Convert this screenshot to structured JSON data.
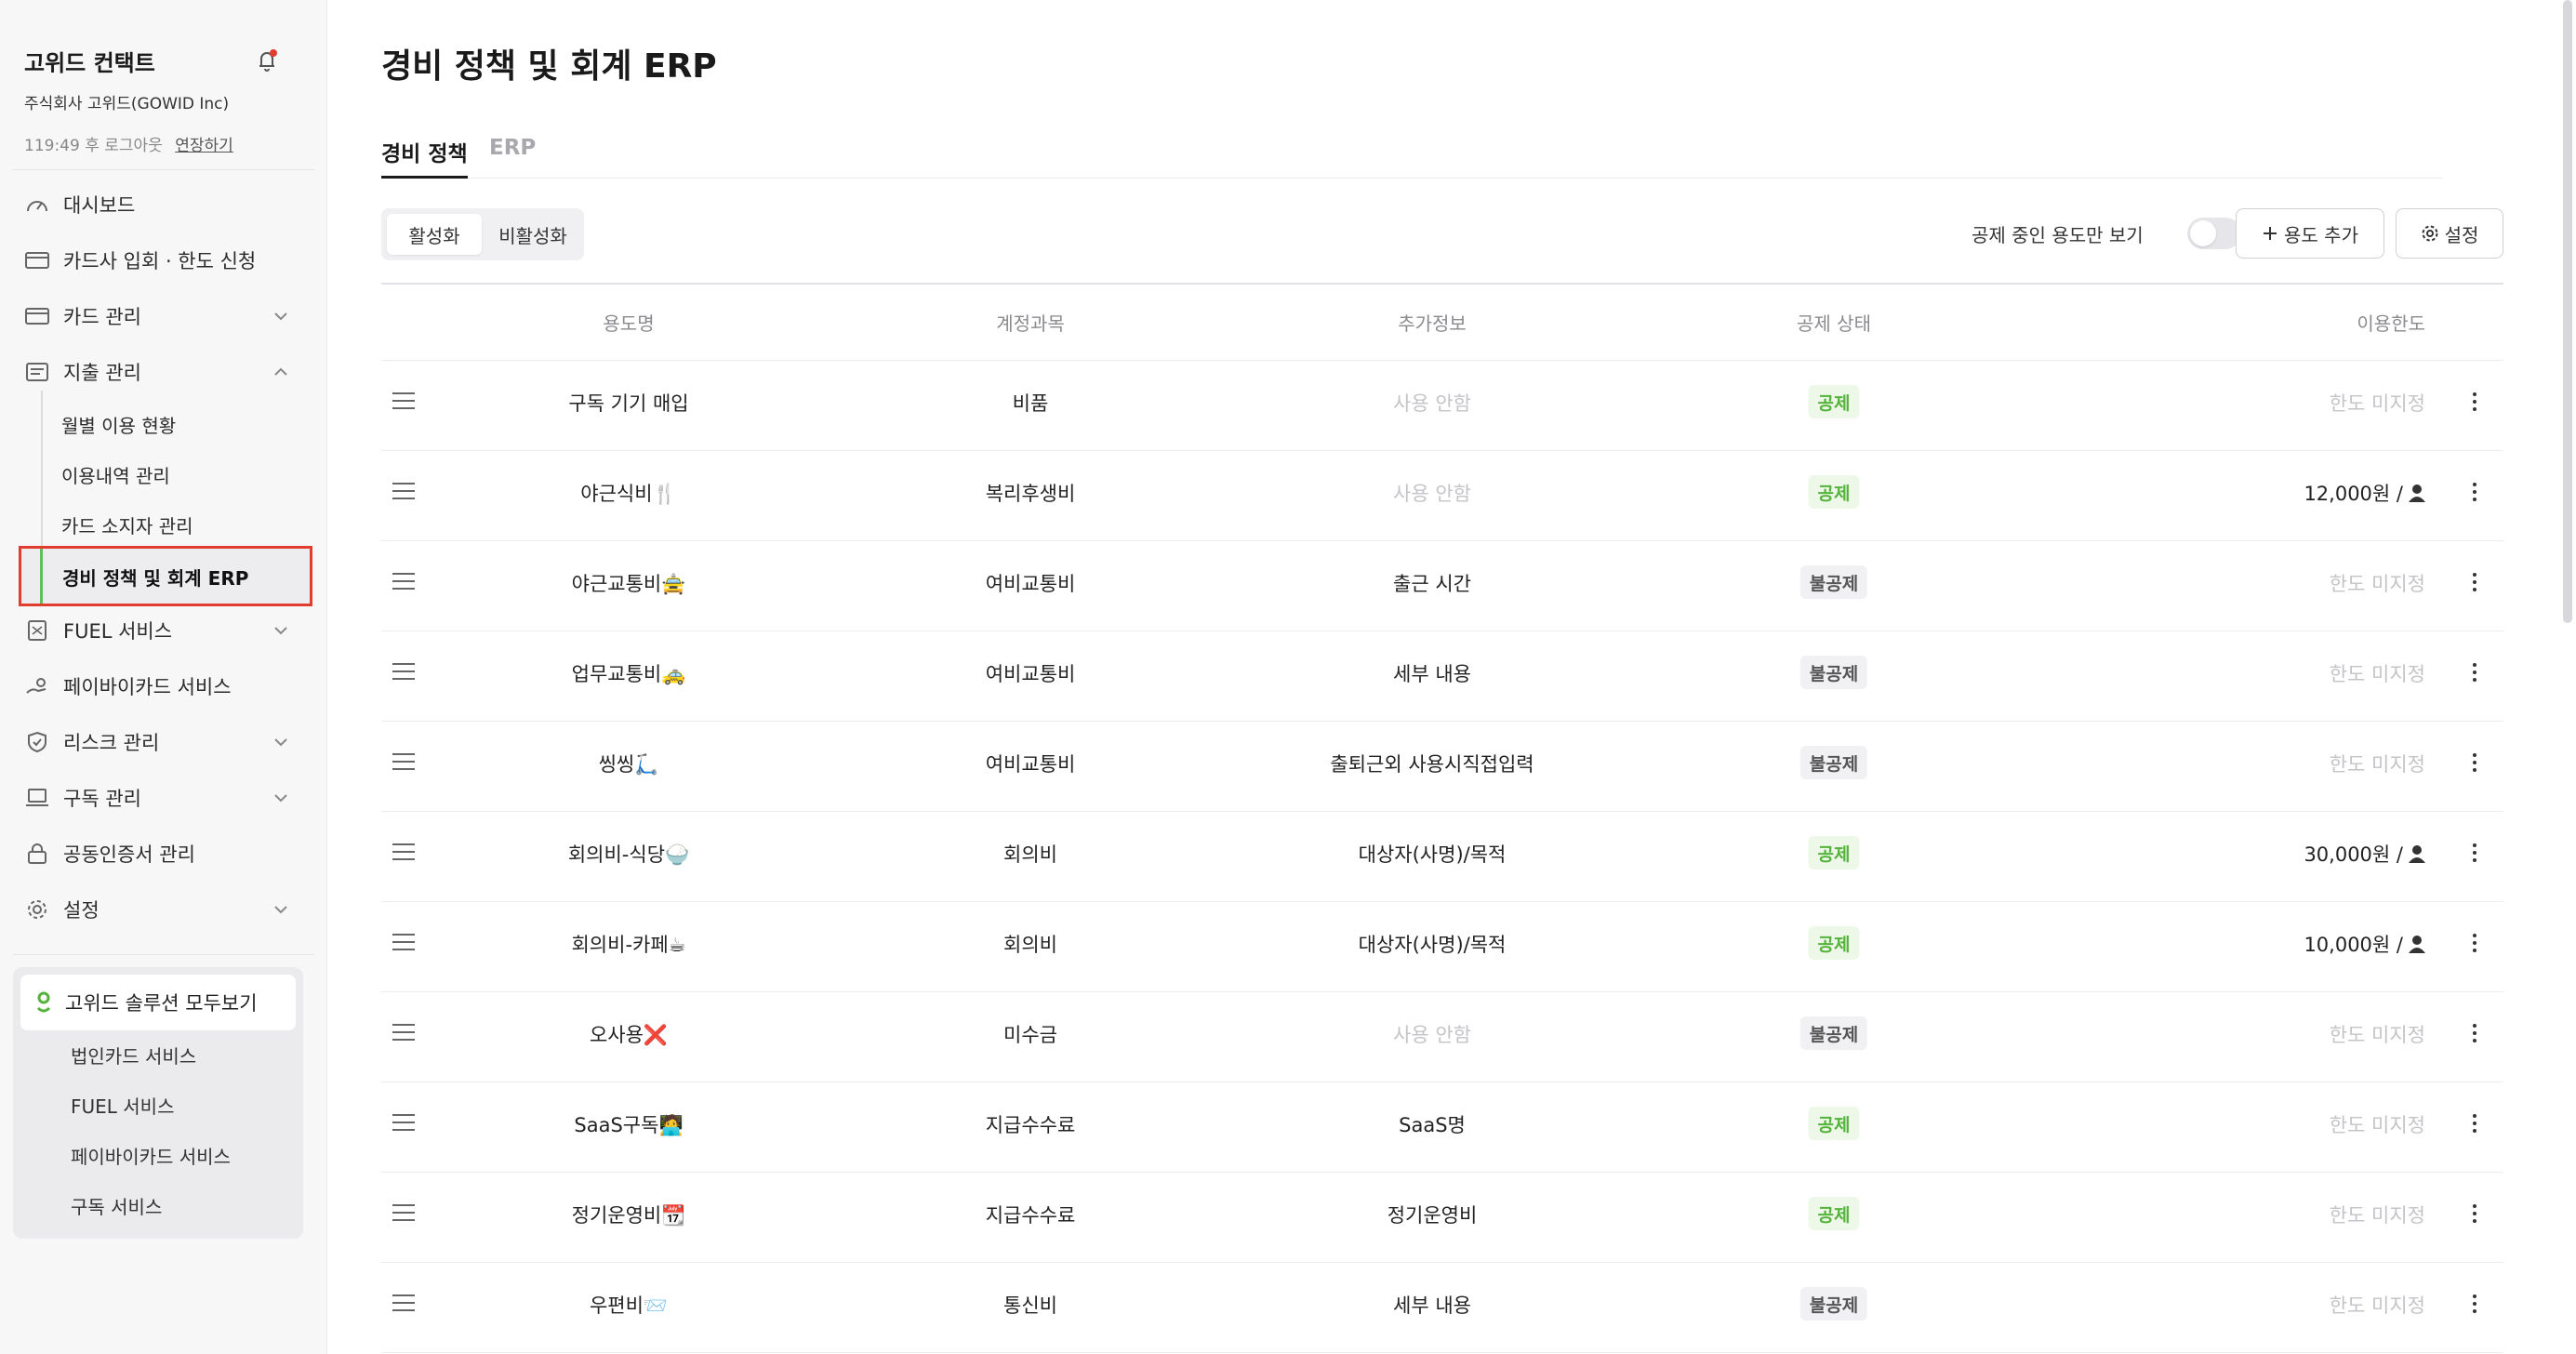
{
  "sidebar": {
    "company_name": "고위드 컨택트",
    "company_sub": "주식회사 고위드(GOWID Inc)",
    "session_text": "119:49 후 로그아웃",
    "extend_label": "연장하기",
    "nav": {
      "dashboard": "대시보드",
      "card_signup": "카드사 입회 · 한도 신청",
      "card_manage": "카드 관리",
      "expense_manage": "지출 관리",
      "fuel": "FUEL 서비스",
      "paybycard": "페이바이카드 서비스",
      "risk": "리스크 관리",
      "subscription": "구독 관리",
      "certificate": "공동인증서 관리",
      "settings": "설정"
    },
    "expense_sub": {
      "monthly": "월별 이용 현황",
      "history": "이용내역 관리",
      "holder": "카드 소지자 관리",
      "policy": "경비 정책 및 회계 ERP"
    },
    "solutions": {
      "head": "고위드 솔루션 모두보기",
      "items": [
        "법인카드 서비스",
        "FUEL 서비스",
        "페이바이카드 서비스",
        "구독 서비스"
      ]
    }
  },
  "main": {
    "title": "경비 정책 및 회계 ERP",
    "tabs": [
      "경비 정책",
      "ERP"
    ],
    "segment": [
      "활성화",
      "비활성화"
    ],
    "toggle_label": "공제 중인 용도만 보기",
    "add_button": "용도 추가",
    "settings_button": "설정"
  },
  "table": {
    "headers": [
      "용도명",
      "계정과목",
      "추가정보",
      "공제 상태",
      "이용한도"
    ],
    "rows": [
      {
        "name": "구독 기기 매입",
        "account": "비품",
        "info": "사용 안함",
        "info_muted": true,
        "status": "공제",
        "limit": "한도 미지정",
        "limit_set": false
      },
      {
        "name": "야근식비🍴",
        "account": "복리후생비",
        "info": "사용 안함",
        "info_muted": true,
        "status": "공제",
        "limit": "12,000원 /",
        "limit_set": true
      },
      {
        "name": "야근교통비🚖",
        "account": "여비교통비",
        "info": "출근 시간",
        "info_muted": false,
        "status": "불공제",
        "limit": "한도 미지정",
        "limit_set": false
      },
      {
        "name": "업무교통비🚕",
        "account": "여비교통비",
        "info": "세부 내용",
        "info_muted": false,
        "status": "불공제",
        "limit": "한도 미지정",
        "limit_set": false
      },
      {
        "name": "씽씽🛴",
        "account": "여비교통비",
        "info": "출퇴근외 사용시직접입력",
        "info_muted": false,
        "status": "불공제",
        "limit": "한도 미지정",
        "limit_set": false
      },
      {
        "name": "회의비-식당🍚",
        "account": "회의비",
        "info": "대상자(사명)/목적",
        "info_muted": false,
        "status": "공제",
        "limit": "30,000원 /",
        "limit_set": true
      },
      {
        "name": "회의비-카페☕",
        "account": "회의비",
        "info": "대상자(사명)/목적",
        "info_muted": false,
        "status": "공제",
        "limit": "10,000원 /",
        "limit_set": true
      },
      {
        "name": "오사용❌",
        "account": "미수금",
        "info": "사용 안함",
        "info_muted": true,
        "status": "불공제",
        "limit": "한도 미지정",
        "limit_set": false
      },
      {
        "name": "SaaS구독🧑‍💻",
        "account": "지급수수료",
        "info": "SaaS명",
        "info_muted": false,
        "status": "공제",
        "limit": "한도 미지정",
        "limit_set": false
      },
      {
        "name": "정기운영비📆",
        "account": "지급수수료",
        "info": "정기운영비",
        "info_muted": false,
        "status": "공제",
        "limit": "한도 미지정",
        "limit_set": false
      },
      {
        "name": "우편비📨",
        "account": "통신비",
        "info": "세부 내용",
        "info_muted": false,
        "status": "불공제",
        "limit": "한도 미지정",
        "limit_set": false
      }
    ]
  },
  "colors": {
    "accent_green": "#54b33a",
    "highlight_red": "#e03d2f",
    "muted_text": "#c4c4c8"
  }
}
